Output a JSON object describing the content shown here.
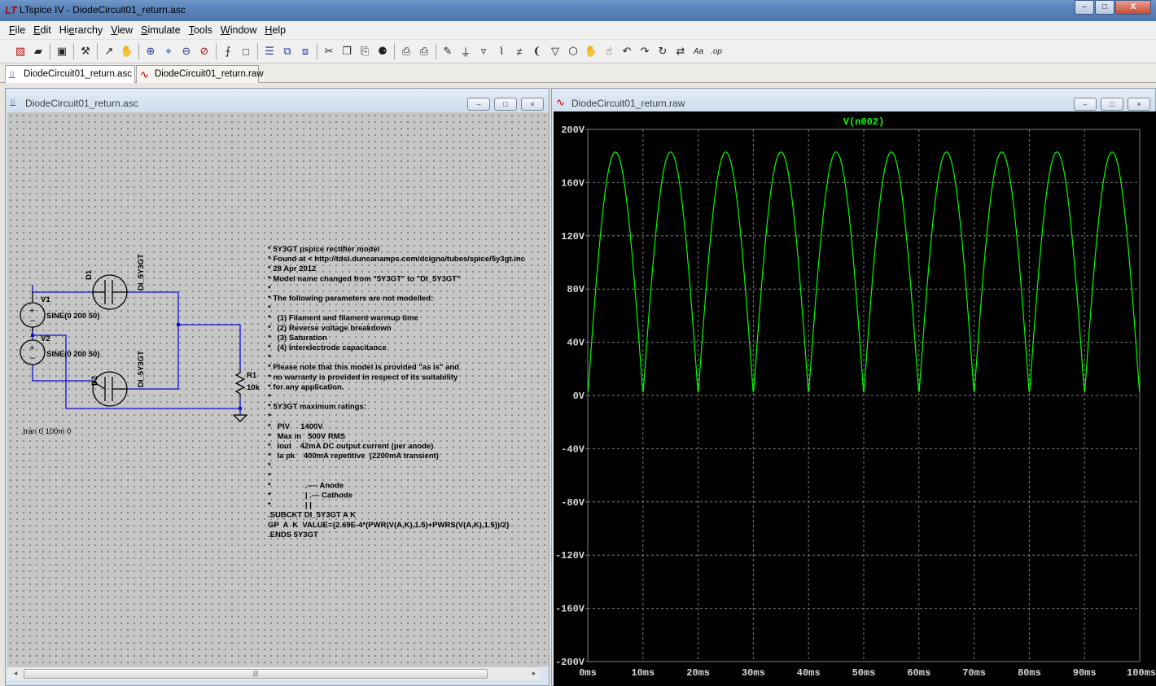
{
  "window": {
    "title": "LTspice IV - DiodeCircuit01_return.asc",
    "icon": "ltspice-logo-icon",
    "icon_text": "LT",
    "minimize": "–",
    "maximize": "□",
    "close": "X"
  },
  "menu": [
    {
      "pre": "",
      "u": "F",
      "post": "ile"
    },
    {
      "pre": "",
      "u": "E",
      "post": "dit"
    },
    {
      "pre": "Hi",
      "u": "e",
      "post": "rarchy"
    },
    {
      "pre": "",
      "u": "V",
      "post": "iew"
    },
    {
      "pre": "",
      "u": "S",
      "post": "imulate"
    },
    {
      "pre": "",
      "u": "T",
      "post": "ools"
    },
    {
      "pre": "",
      "u": "W",
      "post": "indow"
    },
    {
      "pre": "",
      "u": "H",
      "post": "elp"
    }
  ],
  "toolbar": [
    {
      "name": "new-schematic-icon",
      "glyph": "▨",
      "cls": "red"
    },
    {
      "name": "open-icon",
      "glyph": "▰",
      "cls": ""
    },
    {
      "sep": true
    },
    {
      "name": "save-icon",
      "glyph": "▣",
      "cls": ""
    },
    {
      "sep": true
    },
    {
      "name": "control-panel-icon",
      "glyph": "⚒",
      "cls": ""
    },
    {
      "sep": true
    },
    {
      "name": "run-icon",
      "glyph": "↗",
      "cls": ""
    },
    {
      "name": "halt-icon",
      "glyph": "✋",
      "cls": ""
    },
    {
      "sep": true
    },
    {
      "name": "zoom-in-icon",
      "glyph": "⊕",
      "cls": "blue"
    },
    {
      "name": "pan-icon",
      "glyph": "⌖",
      "cls": "blue"
    },
    {
      "name": "zoom-out-icon",
      "glyph": "⊖",
      "cls": "blue"
    },
    {
      "name": "zoom-fit-icon",
      "glyph": "⊘",
      "cls": "red"
    },
    {
      "sep": true
    },
    {
      "name": "autorange-icon",
      "glyph": "⨍",
      "cls": ""
    },
    {
      "name": "delete-traces-icon",
      "glyph": "□",
      "cls": ""
    },
    {
      "sep": true
    },
    {
      "name": "tile-horizontal-icon",
      "glyph": "☰",
      "cls": "blue"
    },
    {
      "name": "cascade-icon",
      "glyph": "⧉",
      "cls": "blue"
    },
    {
      "name": "tile-vertical-icon",
      "glyph": "⧈",
      "cls": "blue"
    },
    {
      "sep": true
    },
    {
      "name": "cut-icon",
      "glyph": "✂",
      "cls": ""
    },
    {
      "name": "copy-icon",
      "glyph": "❐",
      "cls": ""
    },
    {
      "name": "paste-icon",
      "glyph": "⎘",
      "cls": ""
    },
    {
      "name": "find-icon",
      "glyph": "⚈",
      "cls": ""
    },
    {
      "sep": true
    },
    {
      "name": "print-setup-icon",
      "glyph": "⎙",
      "cls": ""
    },
    {
      "name": "print-icon",
      "glyph": "⎙",
      "cls": ""
    },
    {
      "sep": true
    },
    {
      "name": "draw-wire-icon",
      "glyph": "✎",
      "cls": ""
    },
    {
      "name": "ground-icon",
      "glyph": "⏚",
      "cls": ""
    },
    {
      "name": "label-net-icon",
      "glyph": "▿",
      "cls": ""
    },
    {
      "name": "resistor-icon",
      "glyph": "⌇",
      "cls": ""
    },
    {
      "name": "capacitor-icon",
      "glyph": "≠",
      "cls": ""
    },
    {
      "name": "inductor-icon",
      "glyph": "❨",
      "cls": ""
    },
    {
      "name": "diode-icon",
      "glyph": "▽",
      "cls": ""
    },
    {
      "name": "component-icon",
      "glyph": "⬡",
      "cls": ""
    },
    {
      "name": "move-icon",
      "glyph": "✋",
      "cls": ""
    },
    {
      "name": "drag-icon",
      "glyph": "☝",
      "cls": ""
    },
    {
      "name": "undo-icon",
      "glyph": "↶",
      "cls": ""
    },
    {
      "name": "redo-icon",
      "glyph": "↷",
      "cls": ""
    },
    {
      "name": "rotate-icon",
      "glyph": "↻",
      "cls": ""
    },
    {
      "name": "mirror-icon",
      "glyph": "⇄",
      "cls": ""
    },
    {
      "name": "text-icon",
      "glyph": "Aa",
      "cls": ""
    },
    {
      "name": "spice-directive-icon",
      "glyph": ".op",
      "cls": ""
    }
  ],
  "doc_tabs": [
    {
      "label": "DiodeCircuit01_return.asc",
      "icon": "schematic-icon",
      "glyph": "⫫",
      "active": true
    },
    {
      "label": "DiodeCircuit01_return.raw",
      "icon": "waveform-icon",
      "glyph": "∿",
      "active": false
    }
  ],
  "schematic_window": {
    "title": "DiodeCircuit01_return.asc",
    "icon": "schematic-icon",
    "glyph": "⫫",
    "components": {
      "d1_ref": "D1",
      "d1_model": "DI_5Y3GT",
      "d2_ref": "D2",
      "d2_model": "DI_5Y3GT",
      "v1_ref": "V1",
      "v1_value": "SINE(0 200 50)",
      "v2_ref": "V2",
      "v2_value": "SINE(0 200 50)",
      "r1_ref": "R1",
      "r1_value": "10k"
    },
    "tran_directive": ".tran 0 100m 0",
    "model_text": [
      "* 5Y3GT pspice rectifier model",
      "* Found at < http://tdsl.duncanamps.com/dcigna/tubes/spice/5y3gt.inc",
      "* 28 Apr 2012",
      "* Model name changed from \"5Y3GT\" to \"DI_5Y3GT\"",
      "*",
      "* The following parameters are not modelled:",
      "*",
      "*   (1) Filament and filament warmup time",
      "*   (2) Reverse voltage breakdown",
      "*   (3) Saturation",
      "*   (4) Interelectrode capacitance",
      "*",
      "* Please note that this model is provided \"as is\" and",
      "* no warranty is provided in respect of its suitability",
      "* for any application.",
      "*",
      "* 5Y3GT maximum ratings:",
      "*",
      "*   PIV     1400V",
      "*   Max in   500V RMS",
      "*   Iout    42mA DC output current (per anode)",
      "*   Ia pk    400mA repetitive  (2200mA transient)",
      "*",
      "*",
      "*                .---- Anode",
      "*                | .--- Cathode",
      "*                | |",
      ".SUBCKT DI_5Y3GT A K",
      "GP  A  K  VALUE={2.69E-4*(PWR(V(A,K),1.5)+PWRS(V(A,K),1.5))/2}",
      ".ENDS 5Y3GT"
    ],
    "scroll_thumb_label": "|||",
    "scroll_left": "◂",
    "scroll_right": "▸"
  },
  "waveform_window": {
    "title": "DiodeCircuit01_return.raw",
    "icon": "waveform-icon",
    "glyph": "∿"
  },
  "child_controls": {
    "minimize": "–",
    "maximize": "□",
    "close": "×"
  },
  "chart_data": {
    "type": "line",
    "title": "V(n002)",
    "x_ticks": [
      "0ms",
      "10ms",
      "20ms",
      "30ms",
      "40ms",
      "50ms",
      "60ms",
      "70ms",
      "80ms",
      "90ms",
      "100ms"
    ],
    "y_ticks": [
      "200V",
      "160V",
      "120V",
      "80V",
      "40V",
      "0V",
      "-40V",
      "-80V",
      "-120V",
      "-160V",
      "-200V"
    ],
    "xlim": [
      0,
      100
    ],
    "ylim": [
      -200,
      200
    ],
    "x_unit": "ms",
    "y_unit": "V",
    "grid": true,
    "series": [
      {
        "color": "#00ff00",
        "peak": 183,
        "min": 3,
        "frequency_hz": 50,
        "rectified": "full-wave"
      }
    ],
    "colors": {
      "background": "#000000",
      "grid": "#7f7f7f",
      "axis_text": "#d8d8d8",
      "title": "#00ff00"
    }
  }
}
